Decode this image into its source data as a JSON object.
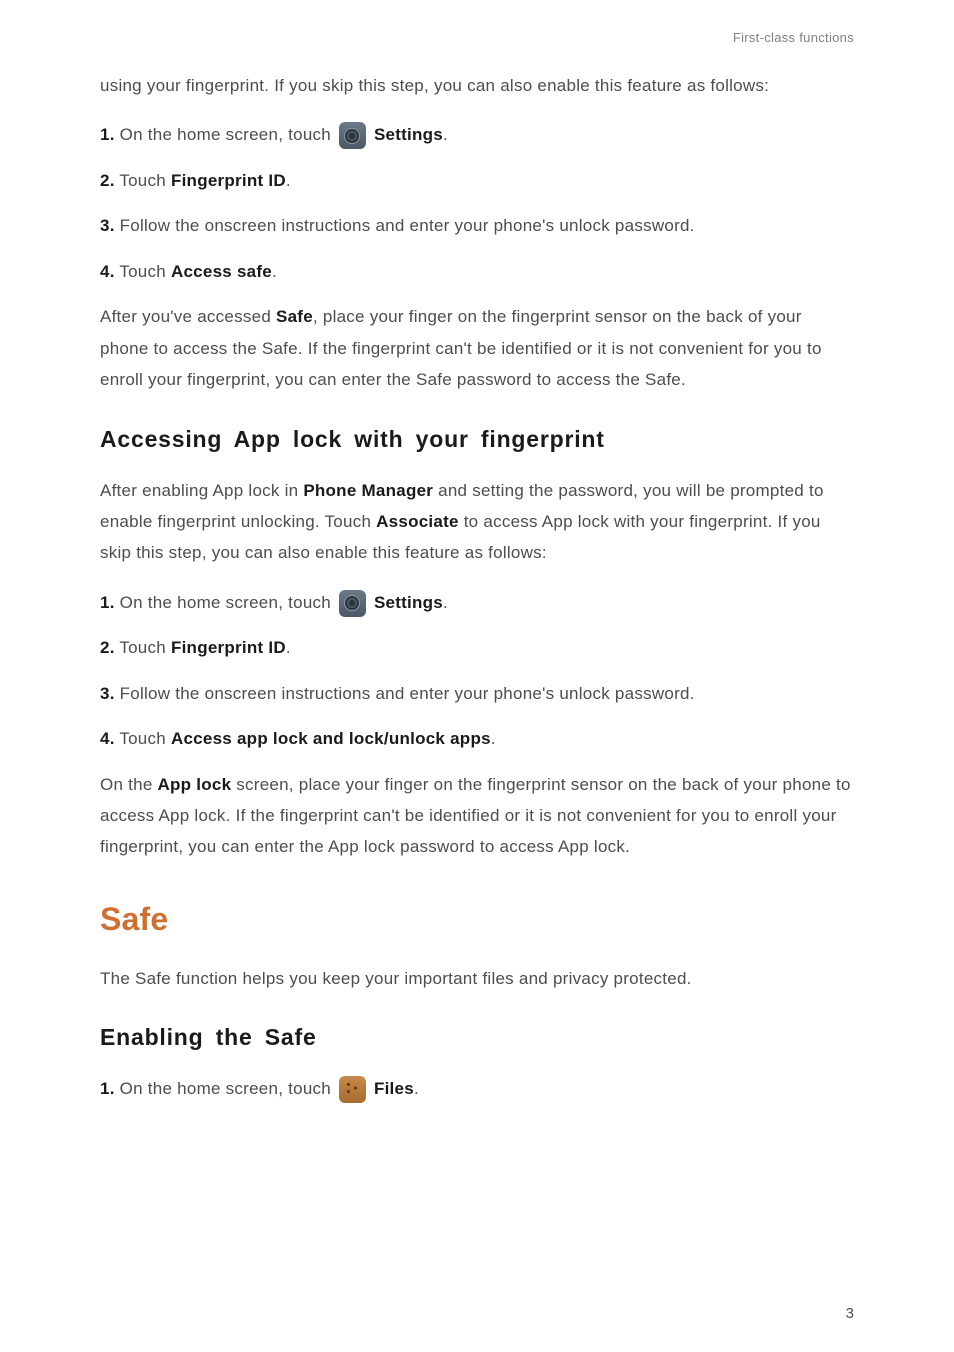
{
  "header": {
    "section_label": "First-class functions"
  },
  "intro": {
    "text": "using your fingerprint. If you skip this step, you can also enable this feature as follows:"
  },
  "stepsA": [
    {
      "num": "1.",
      "pre": " On the home screen, touch ",
      "icon": "settings",
      "post": " ",
      "bold": "Settings",
      "tail": "."
    },
    {
      "num": "2.",
      "pre": " Touch ",
      "bold": "Fingerprint ID",
      "tail": "."
    },
    {
      "num": "3.",
      "pre": " Follow the onscreen instructions and enter your phone's unlock password.",
      "bold": "",
      "tail": ""
    },
    {
      "num": "4.",
      "pre": " Touch ",
      "bold": "Access safe",
      "tail": "."
    }
  ],
  "afterA": {
    "pre": "After you've accessed ",
    "bold": "Safe",
    "mid_tail": ", place your finger on the fingerprint sensor on the back of your phone to access the Safe. If the fingerprint can't be identified or it is not convenient for you to enroll your fingerprint, you can enter the Safe password to access the Safe."
  },
  "headingB": "Accessing App lock with your fingerprint",
  "introB": {
    "p1a": "After enabling App lock in ",
    "p1b_bold": "Phone Manager",
    "p1c": " and setting the password, you will be prompted to enable fingerprint unlocking. Touch ",
    "p1d_bold": "Associate",
    "p1e": " to access App lock with your fingerprint. If you skip this step, you can also enable this feature as follows:"
  },
  "stepsB": [
    {
      "num": "1.",
      "pre": " On the home screen, touch ",
      "icon": "settings",
      "post": " ",
      "bold": "Settings",
      "tail": "."
    },
    {
      "num": "2.",
      "pre": " Touch ",
      "bold": "Fingerprint ID",
      "tail": "."
    },
    {
      "num": "3.",
      "pre": " Follow the onscreen instructions and enter your phone's unlock password.",
      "bold": "",
      "tail": ""
    },
    {
      "num": "4.",
      "pre": " Touch ",
      "bold": "Access app lock and lock/unlock apps",
      "tail": "."
    }
  ],
  "afterB": {
    "pre": "On the ",
    "bold": "App lock",
    "mid_tail": " screen, place your finger on the fingerprint sensor on the back of your phone to access App lock. If the fingerprint can't be identified or it is not convenient for you to enroll your fingerprint, you can enter the App lock password to access App lock."
  },
  "safe": {
    "heading": "Safe",
    "intro": "The Safe function helps you keep your important files and privacy protected.",
    "sub": "Enabling the Safe",
    "step1": {
      "num": "1.",
      "pre": " On the home screen, touch ",
      "icon": "files",
      "post": " ",
      "bold": "Files",
      "tail": "."
    }
  },
  "page_number": "3"
}
